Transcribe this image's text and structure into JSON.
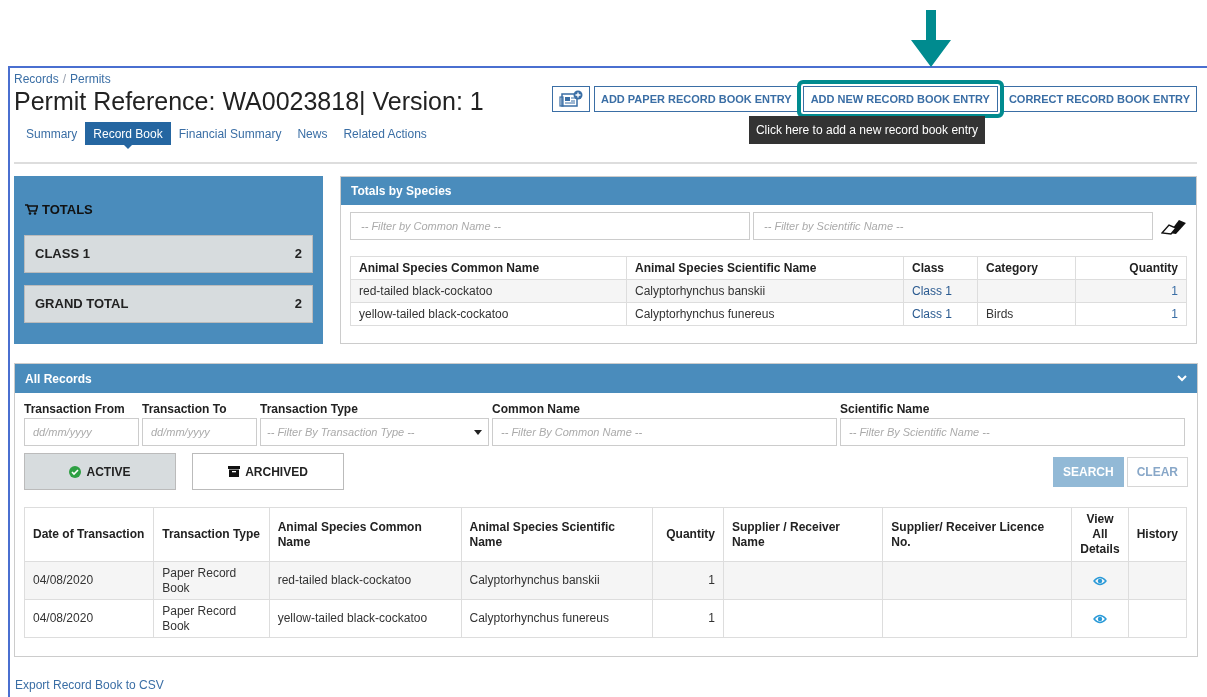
{
  "breadcrumb": {
    "items": [
      "Records",
      "Permits"
    ],
    "separator": "/"
  },
  "title": "Permit Reference: WA0023818| Version: 1",
  "actions": [
    {
      "kind": "icon",
      "highlighted": false
    },
    {
      "kind": "text",
      "label": "ADD PAPER RECORD BOOK ENTRY",
      "highlighted": false
    },
    {
      "kind": "text",
      "label": "ADD NEW RECORD BOOK ENTRY",
      "highlighted": true
    },
    {
      "kind": "text",
      "label": "CORRECT RECORD BOOK ENTRY",
      "highlighted": false
    }
  ],
  "tooltip": "Click here to add a new record book entry",
  "tabs": [
    {
      "label": "Summary",
      "selected": false
    },
    {
      "label": "Record Book",
      "selected": true
    },
    {
      "label": "Financial Summary",
      "selected": false
    },
    {
      "label": "News",
      "selected": false
    },
    {
      "label": "Related Actions",
      "selected": false
    }
  ],
  "totals": {
    "title": "TOTALS",
    "rows": [
      {
        "label": "CLASS 1",
        "value": "2"
      },
      {
        "label": "GRAND TOTAL",
        "value": "2"
      }
    ]
  },
  "species": {
    "title": "Totals by Species",
    "filters": [
      {
        "placeholder": "-- Filter by Common Name --"
      },
      {
        "placeholder": "-- Filter by Scientific Name --"
      }
    ],
    "columns": [
      "Animal Species Common Name",
      "Animal Species Scientific Name",
      "Class",
      "Category",
      "Quantity"
    ],
    "rows": [
      [
        "red-tailed black-cockatoo",
        "Calyptorhynchus banskii",
        "Class 1",
        "",
        "1"
      ],
      [
        "yellow-tailed black-cockatoo",
        "Calyptorhynchus funereus",
        "Class 1",
        "Birds",
        "1"
      ]
    ]
  },
  "records": {
    "title": "All Records",
    "filters": [
      {
        "label": "Transaction From",
        "placeholder": "dd/mm/yyyy",
        "kind": "text"
      },
      {
        "label": "Transaction To",
        "placeholder": "dd/mm/yyyy",
        "kind": "text"
      },
      {
        "label": "Transaction Type",
        "placeholder": "-- Filter By Transaction Type --",
        "kind": "select"
      },
      {
        "label": "Common Name",
        "placeholder": "-- Filter By Common Name --",
        "kind": "text"
      },
      {
        "label": "Scientific Name",
        "placeholder": "-- Filter By Scientific Name --",
        "kind": "text"
      }
    ],
    "toggles": [
      {
        "label": "ACTIVE",
        "selected": true
      },
      {
        "label": "ARCHIVED",
        "selected": false
      }
    ],
    "buttons": [
      {
        "label": "SEARCH",
        "kind": "primary",
        "disabled": true
      },
      {
        "label": "CLEAR",
        "kind": "secondary",
        "disabled": true
      }
    ],
    "columns": [
      "Date of Transaction",
      "Transaction Type",
      "Animal Species Common Name",
      "Animal Species Scientific Name",
      "Quantity",
      "Supplier / Receiver Name",
      "Supplier/ Receiver Licence No.",
      "View All Details",
      "History"
    ],
    "rows": [
      [
        "04/08/2020",
        "Paper Record Book",
        "red-tailed black-cockatoo",
        "Calyptorhynchus banskii",
        "1",
        "",
        "",
        "",
        ""
      ],
      [
        "04/08/2020",
        "Paper Record Book",
        "yellow-tailed black-cockatoo",
        "Calyptorhynchus funereus",
        "1",
        "",
        "",
        "",
        ""
      ]
    ]
  },
  "export": "Export Record Book to CSV"
}
